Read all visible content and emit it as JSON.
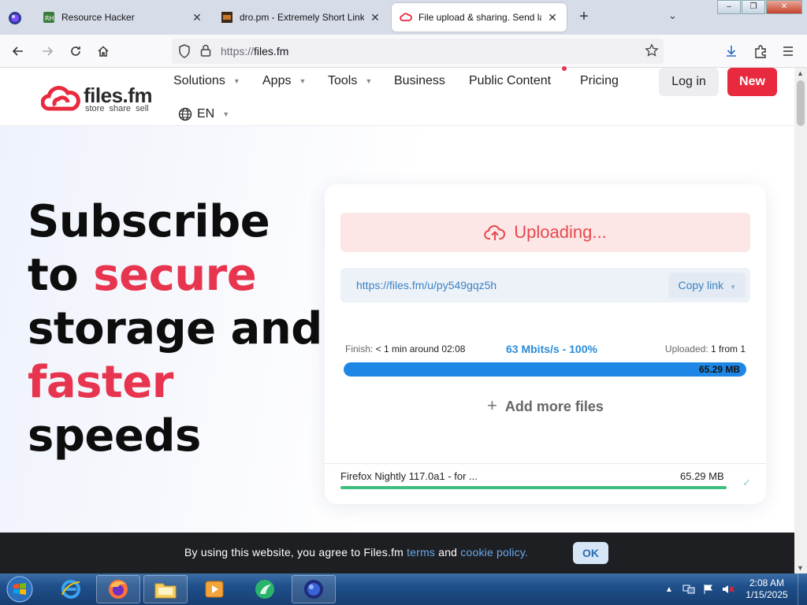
{
  "browser": {
    "tabs": [
      {
        "title": "Resource Hacker",
        "active": false
      },
      {
        "title": "dro.pm - Extremely Short Links",
        "active": false
      },
      {
        "title": "File upload & sharing. Send lar",
        "active": true
      }
    ],
    "url_scheme": "https://",
    "url_host": "files.fm"
  },
  "site": {
    "logo": {
      "name": "files.fm",
      "tagline": "store share sell"
    },
    "menu": [
      {
        "label": "Solutions",
        "dropdown": true
      },
      {
        "label": "Apps",
        "dropdown": true
      },
      {
        "label": "Tools",
        "dropdown": true
      },
      {
        "label": "Business",
        "dropdown": false
      },
      {
        "label": "Public Content",
        "dropdown": false
      },
      {
        "label": "Pricing",
        "dropdown": false
      }
    ],
    "login_label": "Log in",
    "new_label": "New",
    "language": "EN",
    "brand_color": "#e8293e"
  },
  "hero": {
    "line1": "Subscribe",
    "line2a": "to ",
    "line2b": "secure",
    "line3": "storage and",
    "line4": "faster",
    "line5": "speeds"
  },
  "upload": {
    "status": "Uploading...",
    "link": "https://files.fm/u/py549gqz5h",
    "copy_label": "Copy link",
    "finish_key": "Finish:",
    "finish_value": "< 1 min around 02:08",
    "speed": "63 Mbits/s - 100%",
    "uploaded_key": "Uploaded:",
    "uploaded_value": "1 from 1",
    "total_size": "65.29 MB",
    "progress_percent": 100,
    "add_more": "Add more files",
    "file": {
      "name": "Firefox Nightly 117.0a1 - for ...",
      "size": "65.29 MB",
      "progress_percent": 100
    }
  },
  "cookie": {
    "text_before": "By using this website, you agree to Files.fm ",
    "terms": "terms",
    "and": " and ",
    "policy": "cookie policy.",
    "ok": "OK"
  },
  "taskbar": {
    "time": "2:08 AM",
    "date": "1/15/2025"
  }
}
